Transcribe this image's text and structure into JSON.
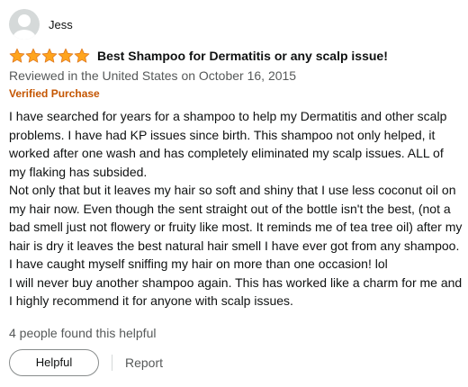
{
  "review": {
    "profile_name": "Jess",
    "rating": 5,
    "max_rating": 5,
    "star_color": "#ffa41c",
    "title": "Best Shampoo for Dermatitis or any scalp issue!",
    "date_line": "Reviewed in the United States on October 16, 2015",
    "verified_label": "Verified Purchase",
    "body": [
      "I have searched for years for a shampoo to help my Dermatitis and other scalp problems. I have had KP issues since birth. This shampoo not only helped, it worked after one wash and has completely eliminated my scalp issues. ALL of my flaking has subsided.",
      "Not only that but it leaves my hair so soft and shiny that I use less coconut oil on my hair now. Even though the sent straight out of the bottle isn't the best, (not a bad smell just not flowery or fruity like most. It reminds me of tea tree oil) after my hair is dry it leaves the best natural hair smell I have ever got from any shampoo. I have caught myself sniffing my hair on more than one occasion! lol",
      "I will never buy another shampoo again. This has worked like a charm for me and I highly recommend it for anyone with scalp issues."
    ],
    "helpful_count_text": "4 people found this helpful",
    "helpful_button_label": "Helpful",
    "report_label": "Report"
  }
}
